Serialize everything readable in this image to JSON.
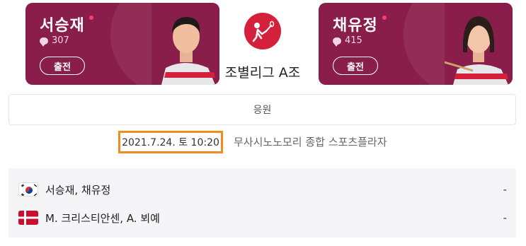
{
  "players": {
    "left": {
      "name": "서승재",
      "comments": "307",
      "status": "출전"
    },
    "right": {
      "name": "채유정",
      "comments": "415",
      "status": "출전"
    }
  },
  "match": {
    "group": "조별리그 A조",
    "cheer_label": "응원",
    "datetime": "2021.7.24. 토 10:20",
    "venue": "무사시노노모리 종합 스포츠플라자"
  },
  "results": [
    {
      "flag": "korea-flag-icon",
      "team": "서승재, 채유정",
      "score": "-"
    },
    {
      "flag": "denmark-flag-icon",
      "team": "M. 크리스티안센, A. 뵈예",
      "score": "-"
    }
  ],
  "colors": {
    "card_bg": "#8a1e4a",
    "accent_red": "#d4203a",
    "highlight_border": "#f28a1e"
  }
}
